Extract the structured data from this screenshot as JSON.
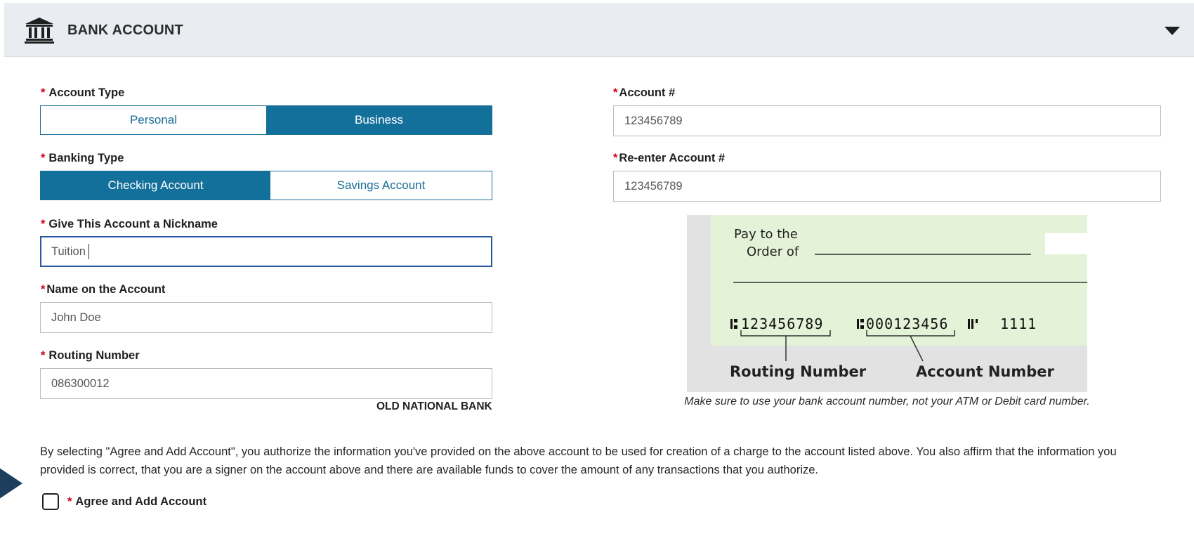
{
  "header": {
    "title": "BANK ACCOUNT",
    "icon": "bank-icon",
    "collapse_icon": "caret-down-icon"
  },
  "account_type": {
    "label": "Account Type",
    "options": [
      "Personal",
      "Business"
    ],
    "selected": "Business"
  },
  "banking_type": {
    "label": "Banking Type",
    "options": [
      "Checking Account",
      "Savings Account"
    ],
    "selected": "Checking Account"
  },
  "nickname": {
    "label": "Give This Account a Nickname",
    "value": "Tuition"
  },
  "name_on_account": {
    "label": "Name on the Account",
    "value": "John Doe"
  },
  "routing": {
    "label": "Routing Number",
    "value": "086300012",
    "bank_name": "OLD NATIONAL BANK"
  },
  "account_number": {
    "label": "Account #",
    "value": "123456789"
  },
  "reenter_account": {
    "label": "Re-enter Account #",
    "value": "123456789"
  },
  "check_image": {
    "pay_to_line1": "Pay to the",
    "pay_to_line2": "Order of",
    "micr_routing": "123456789",
    "micr_account": "000123456",
    "micr_check_number": "1111",
    "routing_caption": "Routing Number",
    "account_caption": "Account Number",
    "note": "Make sure to use your bank account number, not your ATM or Debit card number."
  },
  "disclaimer": "By selecting \"Agree and Add Account\", you authorize the information you've provided on the above account to be used for creation of a charge to the account listed above. You also affirm that the information you provided is correct, that you are a signer on the account above and there are available funds to cover the amount of any transactions that you authorize.",
  "agree": {
    "label": "Agree and Add Account",
    "checked": false
  },
  "required_marker": "*",
  "colors": {
    "primary": "#13709a",
    "required": "#d0021b",
    "header_bg": "#e9edf1",
    "check_bg": "#e4f3d7"
  }
}
